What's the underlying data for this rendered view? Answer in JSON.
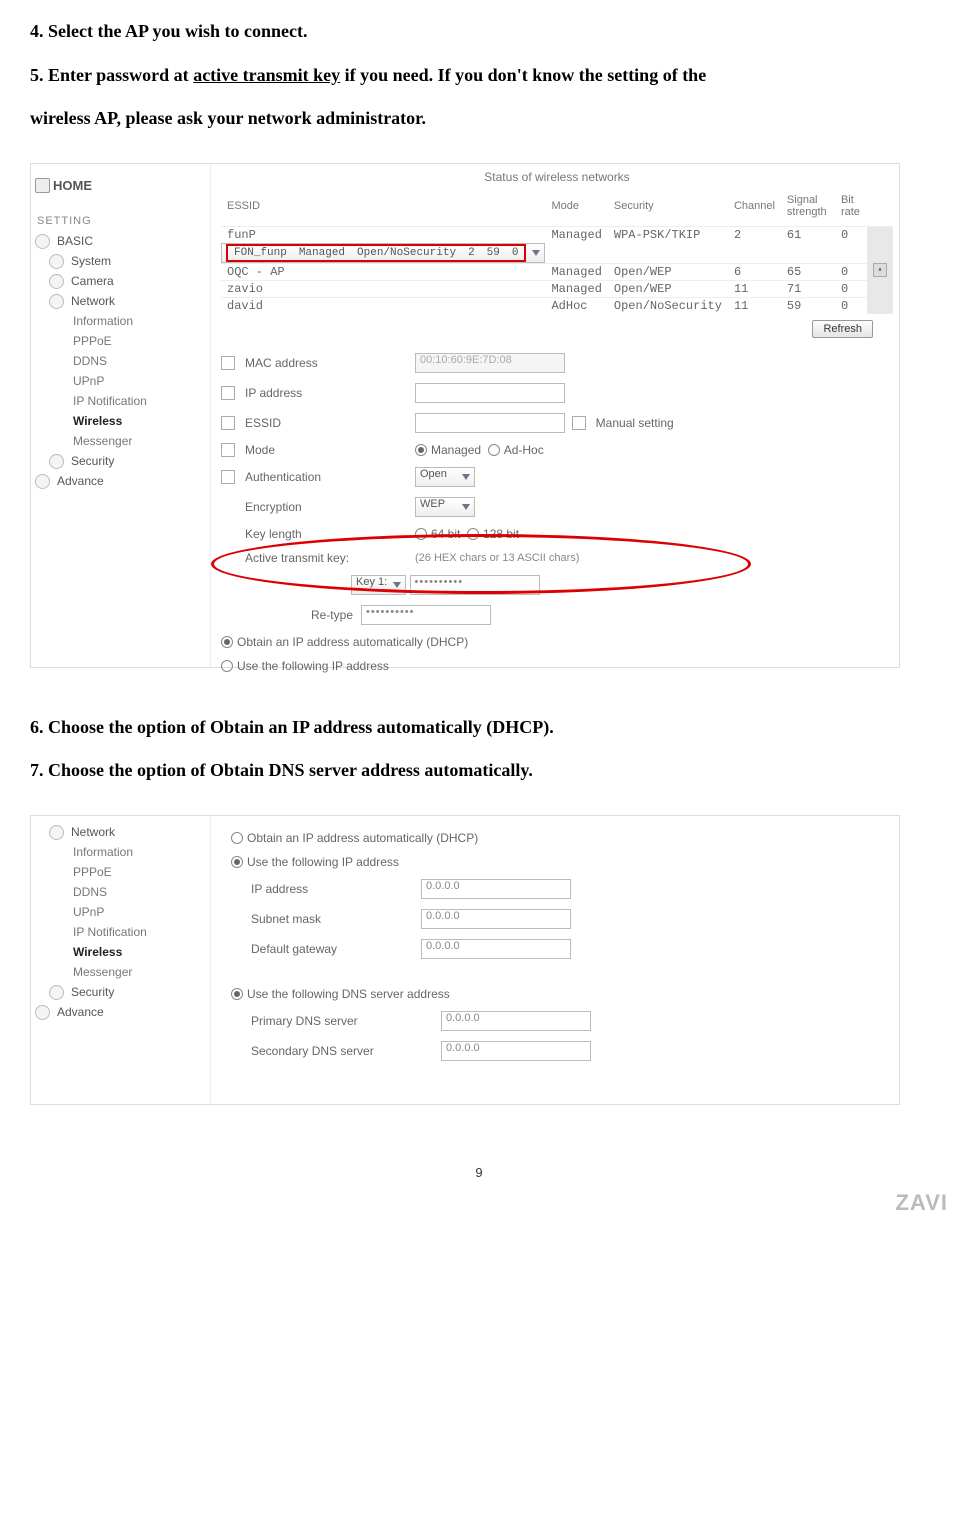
{
  "instructions": {
    "i4": "4. Select the AP you wish to connect.",
    "i5a": "5. Enter password at ",
    "i5u": "active transmit key",
    "i5b": " if you need. If you don't know the setting of the",
    "i5c": "wireless AP, please ask your network administrator.",
    "i6": "6. Choose the option of Obtain an IP address automatically (DHCP).",
    "i7": "7. Choose the option of Obtain DNS server address automatically."
  },
  "nav": {
    "home": "HOME",
    "setting": "SETTING",
    "basic": "BASIC",
    "system": "System",
    "camera": "Camera",
    "network": "Network",
    "information": "Information",
    "pppoe": "PPPoE",
    "ddns": "DDNS",
    "upnp": "UPnP",
    "ipnotif": "IP Notification",
    "wireless": "Wireless",
    "messenger": "Messenger",
    "security": "Security",
    "advance": "Advance"
  },
  "shot1": {
    "status_title": "Status of wireless networks",
    "cols": {
      "essid": "ESSID",
      "mode": "Mode",
      "security": "Security",
      "channel": "Channel",
      "signal": "Signal strength",
      "bitrate": "Bit rate"
    },
    "rows": [
      {
        "essid": "funP",
        "mode": "Managed",
        "security": "WPA-PSK/TKIP",
        "channel": "2",
        "signal": "61",
        "bitrate": "0"
      },
      {
        "essid": "FON_funp",
        "mode": "Managed",
        "security": "Open/NoSecurity",
        "channel": "2",
        "signal": "59",
        "bitrate": "0"
      },
      {
        "essid": "OQC - AP",
        "mode": "Managed",
        "security": "Open/WEP",
        "channel": "6",
        "signal": "65",
        "bitrate": "0"
      },
      {
        "essid": "zavio",
        "mode": "Managed",
        "security": "Open/WEP",
        "channel": "11",
        "signal": "71",
        "bitrate": "0"
      },
      {
        "essid": "david",
        "mode": "AdHoc",
        "security": "Open/NoSecurity",
        "channel": "11",
        "signal": "59",
        "bitrate": "0"
      }
    ],
    "refresh": "Refresh",
    "form": {
      "mac_label": "MAC address",
      "mac_value": "00:10:60:9E:7D:08",
      "ip_label": "IP address",
      "essid_label": "ESSID",
      "manual": "Manual setting",
      "mode_label": "Mode",
      "mode_managed": "Managed",
      "mode_adhoc": "Ad-Hoc",
      "auth_label": "Authentication",
      "auth_value": "Open",
      "enc_label": "Encryption",
      "enc_value": "WEP",
      "keylen_label": "Key length",
      "keylen_64": "64 bit",
      "keylen_128": "128 bit",
      "atk_label": "Active transmit key:",
      "atk_note": "(26 HEX chars or 13 ASCII chars)",
      "key1": "Key 1:",
      "pw_value": "••••••••••",
      "retype": "Re-type",
      "dhcp": "Obtain an IP address automatically (DHCP)",
      "static": "Use the following IP address"
    }
  },
  "shot2": {
    "dhcp": "Obtain an IP address automatically (DHCP)",
    "static": "Use the following IP address",
    "ip_label": "IP address",
    "ip_value": "0.0.0.0",
    "mask_label": "Subnet mask",
    "mask_value": "0.0.0.0",
    "gw_label": "Default gateway",
    "gw_value": "0.0.0.0",
    "dns_static": "Use the following DNS server address",
    "pdns_label": "Primary DNS server",
    "pdns_value": "0.0.0.0",
    "sdns_label": "Secondary DNS server",
    "sdns_value": "0.0.0.0"
  },
  "page": {
    "num": "9",
    "brand": "ZAVI"
  }
}
